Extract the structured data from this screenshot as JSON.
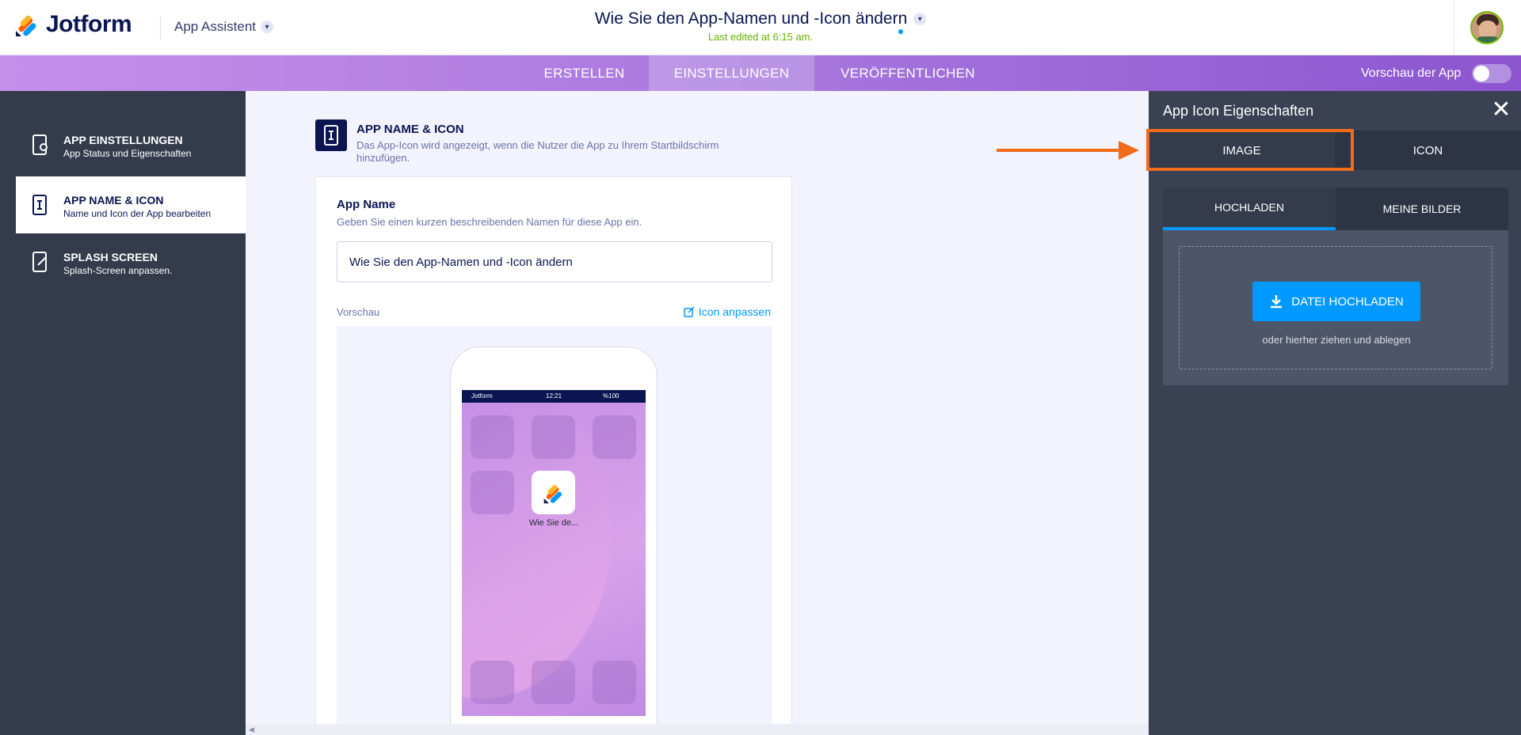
{
  "header": {
    "logo_text": "Jotform",
    "app_assistant_label": "App Assistent",
    "doc_title": "Wie Sie den App-Namen und -Icon ändern",
    "last_edited": "Last edited at 6:15 am."
  },
  "nav": {
    "tabs": [
      {
        "label": "ERSTELLEN"
      },
      {
        "label": "EINSTELLUNGEN"
      },
      {
        "label": "VERÖFFENTLICHEN"
      }
    ],
    "active_tab": "EINSTELLUNGEN",
    "preview_label": "Vorschau der App",
    "preview_toggle_on": false
  },
  "sidebar": {
    "items": [
      {
        "title": "APP EINSTELLUNGEN",
        "subtitle": "App Status und Eigenschaften"
      },
      {
        "title": "APP NAME & ICON",
        "subtitle": "Name und Icon der App bearbeiten"
      },
      {
        "title": "SPLASH SCREEN",
        "subtitle": "Splash-Screen anpassen."
      }
    ],
    "active_item": "APP NAME & ICON"
  },
  "main": {
    "section_title": "APP NAME & ICON",
    "section_desc": "Das App-Icon wird angezeigt, wenn die Nutzer die App zu Ihrem Startbildschirm hinzufügen.",
    "app_name_label": "App Name",
    "app_name_hint": "Geben Sie einen kurzen beschreibenden Namen für diese App ein.",
    "app_name_value": "Wie Sie den App-Namen und -Icon ändern",
    "preview_label": "Vorschau",
    "customize_icon_label": "Icon anpassen",
    "phone": {
      "status_left": "Jotform",
      "status_time": "12:21",
      "status_right": "%100",
      "app_label": "Wie Sie de..."
    }
  },
  "panel": {
    "title": "App Icon Eigenschaften",
    "tabs": [
      {
        "label": "IMAGE"
      },
      {
        "label": "ICON"
      }
    ],
    "active_tab": "IMAGE",
    "upload_tabs": [
      {
        "label": "HOCHLADEN"
      },
      {
        "label": "MEINE BILDER"
      }
    ],
    "active_upload_tab": "HOCHLADEN",
    "upload_button": "DATEI HOCHLADEN",
    "drop_hint": "oder hierher ziehen und ablegen"
  },
  "colors": {
    "accent_blue": "#0099ff",
    "brand_navy": "#0a1551",
    "highlight_orange": "#f06b1a",
    "last_edited_green": "#64b200"
  }
}
